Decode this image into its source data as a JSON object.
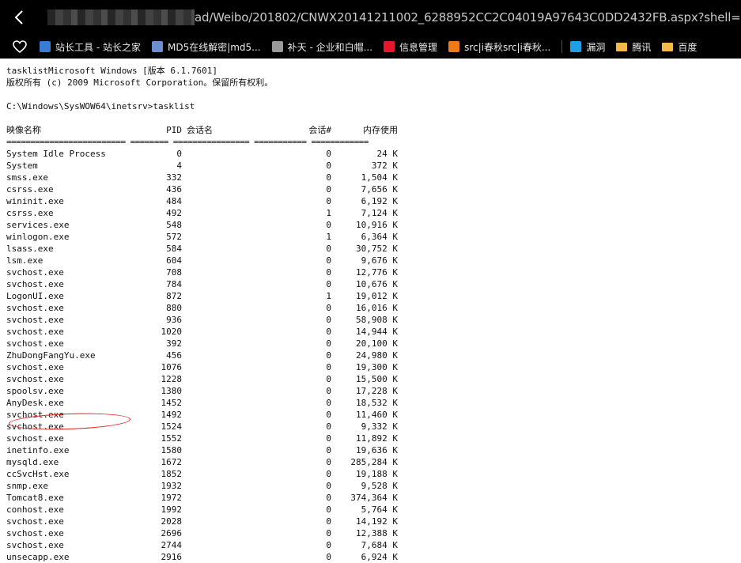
{
  "browser": {
    "url_visible": "ad/Weibo/201802/CNWX20141211002_6288952CC2C04019A97643C0DD2432FB.aspx?shell=C:\\WINDOWS\\",
    "bookmarks": [
      {
        "label": "站长工具 - 站长之家",
        "icon": "site-tools-icon",
        "color": "#3a7bd5"
      },
      {
        "label": "MD5在线解密|md5...",
        "icon": "md5-icon",
        "color": "#6c8fd1"
      },
      {
        "label": "补天 - 企业和白帽...",
        "icon": "butian-icon",
        "color": "#9a9a9a"
      },
      {
        "label": "信息管理",
        "icon": "weibo-icon",
        "color": "#e6162d"
      },
      {
        "label": "src|i春秋src|i春秋...",
        "icon": "ichunqiu-icon",
        "color": "#f07a18"
      },
      {
        "label": "漏洞",
        "icon": "windows-icon",
        "color": "#1ea0e6"
      },
      {
        "label": "腾讯",
        "icon": "folder-icon",
        "color": "#f3b94a"
      },
      {
        "label": "百度",
        "icon": "folder-icon",
        "color": "#f3b94a"
      }
    ]
  },
  "console": {
    "header_line1": "tasklistMicrosoft Windows [版本 6.1.7601]",
    "header_line2": "版权所有 (c) 2009 Microsoft Corporation。保留所有权利。",
    "prompt": "C:\\Windows\\SysWOW64\\inetsrv>tasklist",
    "columns": {
      "name": "映像名称",
      "pid": "PID",
      "session": "会话名",
      "session_num": "会话#",
      "mem": "内存使用"
    },
    "separator": "========================= ======== ================ =========== ============",
    "rows": [
      {
        "name": "System Idle Process",
        "pid": "0",
        "snum": "0",
        "mem": "24 K"
      },
      {
        "name": "System",
        "pid": "4",
        "snum": "0",
        "mem": "372 K"
      },
      {
        "name": "smss.exe",
        "pid": "332",
        "snum": "0",
        "mem": "1,504 K"
      },
      {
        "name": "csrss.exe",
        "pid": "436",
        "snum": "0",
        "mem": "7,656 K"
      },
      {
        "name": "wininit.exe",
        "pid": "484",
        "snum": "0",
        "mem": "6,192 K"
      },
      {
        "name": "csrss.exe",
        "pid": "492",
        "snum": "1",
        "mem": "7,124 K"
      },
      {
        "name": "services.exe",
        "pid": "548",
        "snum": "0",
        "mem": "10,916 K"
      },
      {
        "name": "winlogon.exe",
        "pid": "572",
        "snum": "1",
        "mem": "6,364 K"
      },
      {
        "name": "lsass.exe",
        "pid": "584",
        "snum": "0",
        "mem": "30,752 K"
      },
      {
        "name": "lsm.exe",
        "pid": "604",
        "snum": "0",
        "mem": "9,676 K"
      },
      {
        "name": "svchost.exe",
        "pid": "708",
        "snum": "0",
        "mem": "12,776 K"
      },
      {
        "name": "svchost.exe",
        "pid": "784",
        "snum": "0",
        "mem": "10,676 K"
      },
      {
        "name": "LogonUI.exe",
        "pid": "872",
        "snum": "1",
        "mem": "19,012 K"
      },
      {
        "name": "svchost.exe",
        "pid": "880",
        "snum": "0",
        "mem": "16,016 K"
      },
      {
        "name": "svchost.exe",
        "pid": "936",
        "snum": "0",
        "mem": "58,908 K"
      },
      {
        "name": "svchost.exe",
        "pid": "1020",
        "snum": "0",
        "mem": "14,944 K"
      },
      {
        "name": "svchost.exe",
        "pid": "392",
        "snum": "0",
        "mem": "20,100 K"
      },
      {
        "name": "ZhuDongFangYu.exe",
        "pid": "456",
        "snum": "0",
        "mem": "24,980 K"
      },
      {
        "name": "svchost.exe",
        "pid": "1076",
        "snum": "0",
        "mem": "19,300 K"
      },
      {
        "name": "svchost.exe",
        "pid": "1228",
        "snum": "0",
        "mem": "15,500 K"
      },
      {
        "name": "spoolsv.exe",
        "pid": "1380",
        "snum": "0",
        "mem": "17,228 K"
      },
      {
        "name": "AnyDesk.exe",
        "pid": "1452",
        "snum": "0",
        "mem": "18,532 K"
      },
      {
        "name": "svchost.exe",
        "pid": "1492",
        "snum": "0",
        "mem": "11,460 K"
      },
      {
        "name": "svchost.exe",
        "pid": "1524",
        "snum": "0",
        "mem": "9,332 K"
      },
      {
        "name": "svchost.exe",
        "pid": "1552",
        "snum": "0",
        "mem": "11,892 K"
      },
      {
        "name": "inetinfo.exe",
        "pid": "1580",
        "snum": "0",
        "mem": "19,636 K"
      },
      {
        "name": "mysqld.exe",
        "pid": "1672",
        "snum": "0",
        "mem": "285,284 K"
      },
      {
        "name": "ccSvcHst.exe",
        "pid": "1852",
        "snum": "0",
        "mem": "19,188 K"
      },
      {
        "name": "snmp.exe",
        "pid": "1932",
        "snum": "0",
        "mem": "9,528 K"
      },
      {
        "name": "Tomcat8.exe",
        "pid": "1972",
        "snum": "0",
        "mem": "374,364 K"
      },
      {
        "name": "conhost.exe",
        "pid": "1992",
        "snum": "0",
        "mem": "5,764 K"
      },
      {
        "name": "svchost.exe",
        "pid": "2028",
        "snum": "0",
        "mem": "14,192 K"
      },
      {
        "name": "svchost.exe",
        "pid": "2696",
        "snum": "0",
        "mem": "12,388 K"
      },
      {
        "name": "svchost.exe",
        "pid": "2744",
        "snum": "0",
        "mem": "7,684 K"
      },
      {
        "name": "unsecapp.exe",
        "pid": "2916",
        "snum": "0",
        "mem": "6,924 K"
      }
    ]
  }
}
